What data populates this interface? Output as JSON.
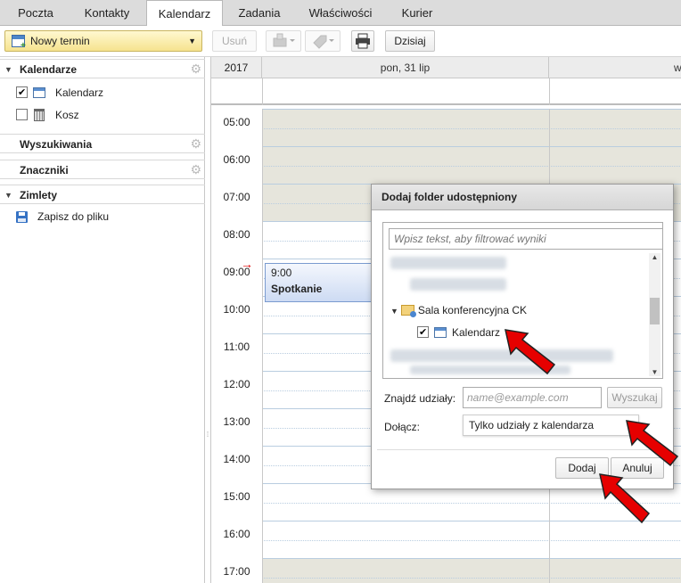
{
  "tabs": [
    "Poczta",
    "Kontakty",
    "Kalendarz",
    "Zadania",
    "Właściwości",
    "Kurier"
  ],
  "toolbar": {
    "new_label": "Nowy termin",
    "delete_label": "Usuń",
    "today_label": "Dzisiaj"
  },
  "sidebar": {
    "calendars_header": "Kalendarze",
    "calendars": [
      {
        "label": "Kalendarz",
        "checked": true
      },
      {
        "label": "Kosz",
        "checked": false
      }
    ],
    "search_header": "Wyszukiwania",
    "tags_header": "Znaczniki",
    "zimlets_header": "Zimlety",
    "zimlet_item": "Zapisz do pliku"
  },
  "calendar": {
    "year": "2017",
    "day1": "pon, 31 lip",
    "day2": "w",
    "hours": [
      "05:00",
      "06:00",
      "07:00",
      "08:00",
      "09:00",
      "10:00",
      "11:00",
      "12:00",
      "13:00",
      "14:00",
      "15:00",
      "16:00",
      "17:00"
    ],
    "event": {
      "time": "9:00",
      "title": "Spotkanie"
    }
  },
  "dialog": {
    "title": "Dodaj folder udostępniony",
    "filter_placeholder": "Wpisz tekst, aby filtrować wyniki",
    "tree_folder": "Sala konferencyjna CK",
    "tree_item": "Kalendarz",
    "find_label": "Znajdź udziały:",
    "find_placeholder": "name@example.com",
    "search_btn": "Wyszukaj",
    "include_label": "Dołącz:",
    "include_value": "Tylko udziały z kalendarza",
    "add_btn": "Dodaj",
    "cancel_btn": "Anuluj"
  }
}
